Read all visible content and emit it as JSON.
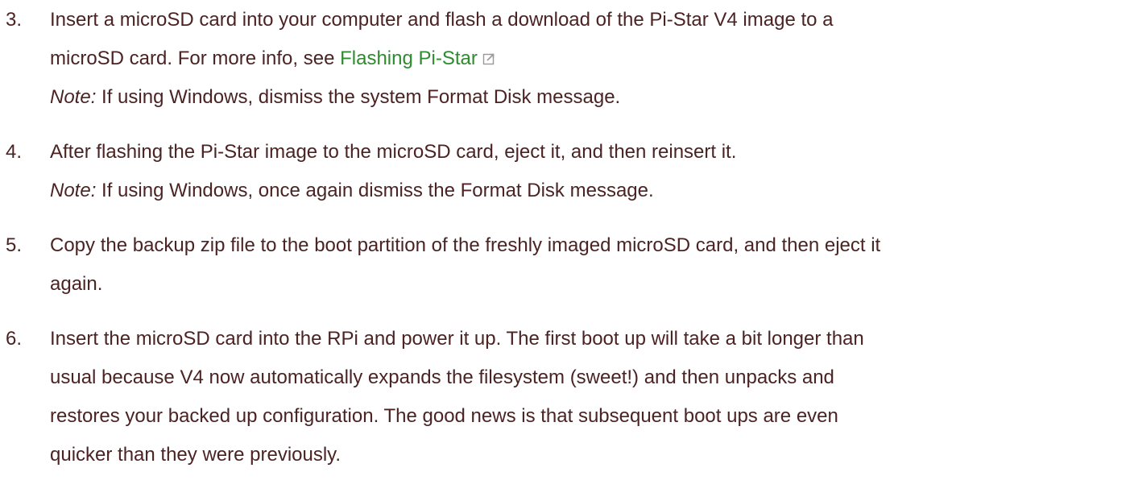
{
  "steps": [
    {
      "number": "3.",
      "lines": [
        "Insert a microSD card into your computer and flash a download of the Pi-Star V4 image to a",
        "microSD card. For more info, see "
      ],
      "link": "Flashing Pi-Star",
      "link_icon": "external-link-icon",
      "note_label": "Note:",
      "note_text": " If using Windows, dismiss the system Format Disk message."
    },
    {
      "number": "4.",
      "lines": [
        "After flashing the Pi-Star image to the microSD card, eject it, and then reinsert it."
      ],
      "note_label": "Note:",
      "note_text": " If using Windows, once again dismiss the Format Disk message."
    },
    {
      "number": "5.",
      "lines": [
        "Copy the backup zip file to the boot partition of the freshly imaged microSD card, and then eject it",
        "again."
      ]
    },
    {
      "number": "6.",
      "lines": [
        "Insert the microSD card into the RPi and power it up. The first boot up will take a bit longer than",
        "usual because V4 now automatically expands the filesystem (sweet!) and then unpacks and",
        "restores your backed up configuration. The good news is that subsequent boot ups are even",
        "quicker than they were previously."
      ]
    }
  ],
  "colors": {
    "text": "#4b2323",
    "link": "#2e8b2e"
  }
}
